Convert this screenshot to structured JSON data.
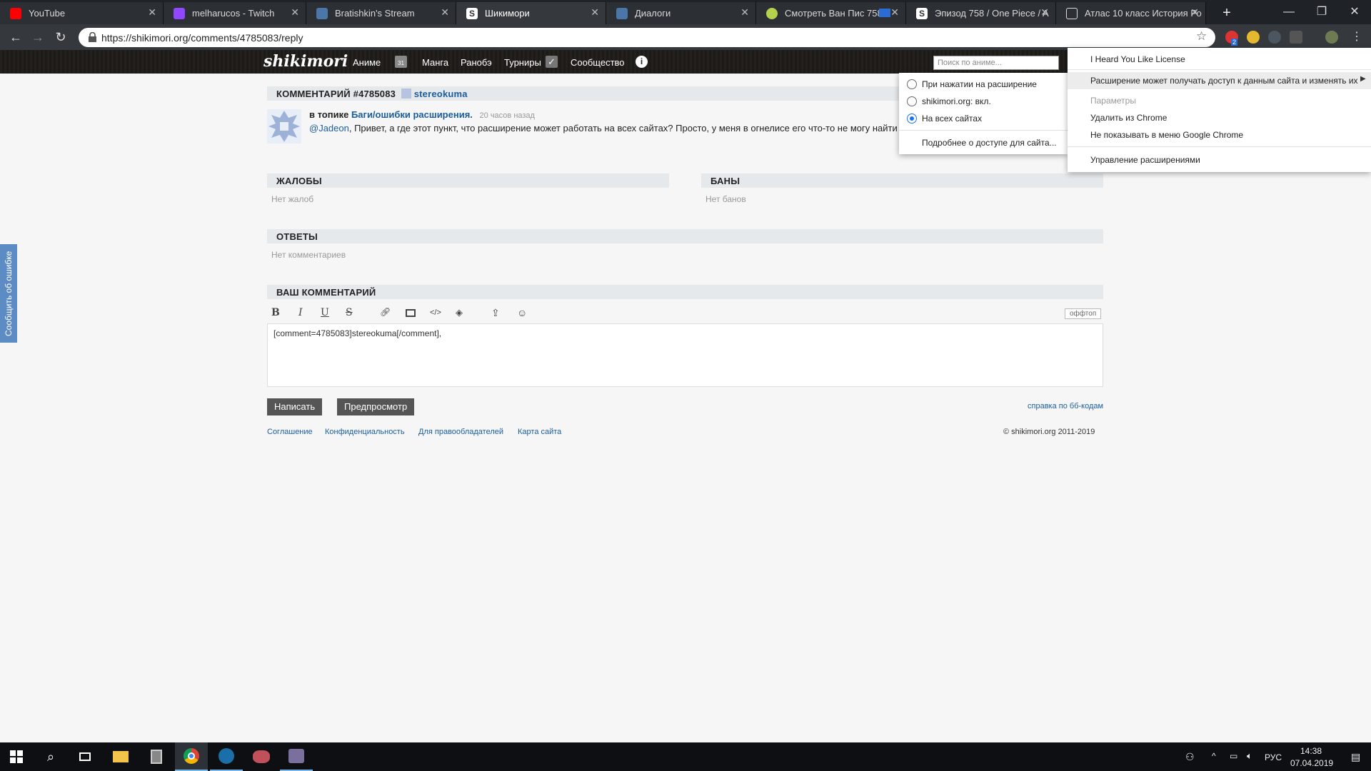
{
  "browser": {
    "tabs": [
      {
        "title": "YouTube",
        "icon": "youtube-icon",
        "color": "#ff0000"
      },
      {
        "title": "melharucos - Twitch",
        "icon": "twitch-icon",
        "color": "#9146ff"
      },
      {
        "title": "Bratishkin's Stream",
        "icon": "vk-icon",
        "color": "#4a76a8"
      },
      {
        "title": "Шикимори",
        "icon": "shikimori-icon",
        "color": "#dddddd"
      },
      {
        "title": "Диалоги",
        "icon": "vk-messages-icon",
        "color": "#4a76a8"
      },
      {
        "title": "Смотреть Ван Пис 758",
        "icon": "anime-site-icon",
        "color": "#b5d24c"
      },
      {
        "title": "Эпизод 758 / One Piece / A",
        "icon": "shikimori-icon",
        "color": "#dddddd"
      },
      {
        "title": "Атлас 10 класс История Ро",
        "icon": "document-icon",
        "color": "#dddddd"
      }
    ],
    "new_tab": "+",
    "url": "https://shikimori.org/comments/4785083/reply",
    "extension_badge": "2"
  },
  "site": {
    "logo": "shikimori",
    "nav": [
      "Аниме",
      "Манга",
      "Ранобэ",
      "Турниры",
      "Сообщество"
    ],
    "calendar_day": "31",
    "search_placeholder": "Поиск по аниме..."
  },
  "comment": {
    "header": "КОММЕНТАРИЙ #4785083",
    "author": "stereokuma",
    "topic_prefix": "в топике",
    "topic_link": "Баги/ошибки расширения.",
    "time": "20 часов назад",
    "mention": "@Jadeon",
    "text": ", Привет, а где этот пункт, что расширение может работать на всех сайтах? Просто, у меня в огнелисе его что-то не могу найти"
  },
  "sections": {
    "complaints_title": "ЖАЛОБЫ",
    "complaints_empty": "Нет жалоб",
    "bans_title": "БАНЫ",
    "bans_empty": "Нет банов",
    "replies_title": "ОТВЕТЫ",
    "replies_empty": "Нет комментариев",
    "your_comment_title": "ВАШ КОММЕНТАРИЙ"
  },
  "editor": {
    "toolbar": [
      "bold-icon",
      "italic-icon",
      "underline-icon",
      "strikethrough-icon",
      "link-icon",
      "image-icon",
      "code-icon",
      "spoiler-icon",
      "upload-icon",
      "smiley-icon"
    ],
    "offtopic": "оффтоп",
    "value": "[comment=4785083]stereokuma[/comment],",
    "submit": "Написать",
    "preview": "Предпросмотр",
    "bbcode_help": "справка по бб-кодам"
  },
  "footer": {
    "links": [
      "Соглашение",
      "Конфиденциальность",
      "Для правообладателей",
      "Карта сайта"
    ],
    "copyright": "© shikimori.org 2011-2019"
  },
  "feedback": "Сообщить об ошибке",
  "site_access_popup": {
    "options": [
      {
        "label": "При нажатии на расширение",
        "selected": false
      },
      {
        "label": "shikimori.org: вкл.",
        "selected": false
      },
      {
        "label": "На всех сайтах",
        "selected": true
      }
    ],
    "more": "Подробнее о доступе для сайта..."
  },
  "extension_menu": {
    "items": [
      {
        "label": "I Heard You Like License",
        "disabled": false
      },
      {
        "label": "Расширение может получать доступ к данным сайта и изменять их",
        "disabled": false,
        "submenu": true
      },
      {
        "label": "Параметры",
        "disabled": true
      },
      {
        "label": "Удалить из Chrome",
        "disabled": false
      },
      {
        "label": "Не показывать в меню Google Chrome",
        "disabled": false
      },
      {
        "label": "Управление расширениями",
        "disabled": false
      }
    ]
  },
  "taskbar": {
    "apps": [
      "windows-start-icon",
      "search-icon",
      "task-view-icon",
      "file-explorer-icon",
      "calculator-icon",
      "chrome-icon",
      "steam-icon",
      "game-app-icon",
      "messages-app-icon"
    ],
    "lang": "РУС",
    "time": "14:38",
    "date": "07.04.2019"
  }
}
